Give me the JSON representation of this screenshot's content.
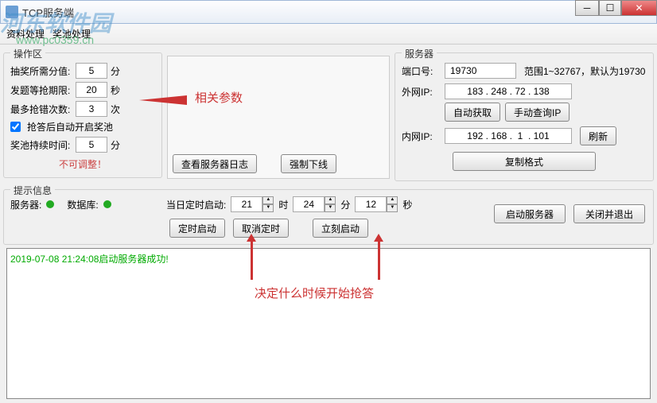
{
  "window": {
    "title": "TCP服务端"
  },
  "menu": {
    "item1": "资料处理",
    "item2": "奖池处理"
  },
  "watermark": {
    "text": "河东软件园",
    "url": "www.pc0359.cn"
  },
  "operation_area": {
    "title": "操作区",
    "score_label": "抽奖所需分值:",
    "score_value": "5",
    "score_unit": "分",
    "time_limit_label": "发题等抢期限:",
    "time_limit_value": "20",
    "time_limit_unit": "秒",
    "max_error_label": "最多抢错次数:",
    "max_error_value": "3",
    "max_error_unit": "次",
    "auto_open_label": "抢答后自动开启奖池",
    "pool_duration_label": "奖池持续时间:",
    "pool_duration_value": "5",
    "pool_duration_unit": "分",
    "no_adjust": "不可调整！"
  },
  "mid": {
    "view_log": "查看服务器日志",
    "force_offline": "强制下线"
  },
  "server": {
    "title": "服务器",
    "port_label": "端口号:",
    "port_value": "19730",
    "port_hint": "范围1~32767，默认为19730",
    "wan_label": "外网IP:",
    "wan_value": "183 . 248 . 72 . 138",
    "auto_get": "自动获取",
    "manual_query": "手动查询IP",
    "lan_label": "内网IP:",
    "lan_value": "192 . 168 .  1  . 101",
    "refresh": "刷新",
    "copy_format": "复制格式"
  },
  "tips": {
    "title": "提示信息",
    "server_label": "服务器:",
    "db_label": "数据库:",
    "timer_label": "当日定时启动:",
    "hour_value": "21",
    "hour_unit": "时",
    "min_value": "24",
    "min_unit": "分",
    "sec_value": "12",
    "sec_unit": "秒",
    "timer_start": "定时启动",
    "cancel_timer": "取消定时",
    "start_now": "立刻启动",
    "start_server": "启动服务器",
    "close_exit": "关闭并退出"
  },
  "log": {
    "line1": "2019-07-08 21:24:08启动服务器成功!"
  },
  "annotations": {
    "params": "相关参数",
    "timing": "决定什么时候开始抢答"
  }
}
